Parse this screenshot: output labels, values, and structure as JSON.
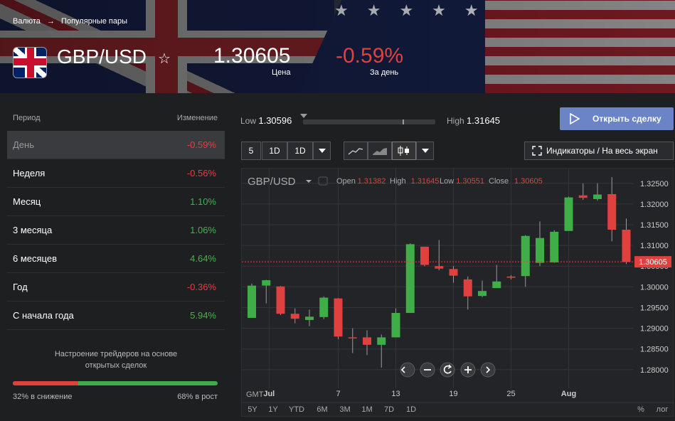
{
  "header": {
    "breadcrumb": [
      "Валюта",
      "Популярные пары"
    ],
    "pair": "GBP/USD",
    "price": "1.30605",
    "price_label": "Цена",
    "change": "-0.59%",
    "change_label": "За день"
  },
  "periods": {
    "col_period": "Период",
    "col_change": "Изменение",
    "rows": [
      {
        "label": "День",
        "value": "-0.59%"
      },
      {
        "label": "Неделя",
        "value": "-0.56%"
      },
      {
        "label": "Месяц",
        "value": "1.10%"
      },
      {
        "label": "3 месяца",
        "value": "1.06%"
      },
      {
        "label": "6 месяцев",
        "value": "4.64%"
      },
      {
        "label": "Год",
        "value": "-0.36%"
      },
      {
        "label": "С начала года",
        "value": "5.94%"
      }
    ]
  },
  "sentiment": {
    "title": "Настроение трейдеров на основе открытых сделок",
    "down_percent": 32,
    "down_label": "32% в снижение",
    "up_label": "68% в рост"
  },
  "range": {
    "low_label": "Low",
    "low": "1.30596",
    "high_label": "High",
    "high": "1.31645"
  },
  "actions": {
    "open_trade": "Открыть сделку",
    "indicators": "Индикаторы / На весь экран"
  },
  "toolbar": {
    "interval_5": "5",
    "interval_1d": "1D",
    "interval_1d_b": "1D"
  },
  "chart_data": {
    "type": "candlestick",
    "symbol": "GBP/USD",
    "ohlc_labels": {
      "open": "Open",
      "high": "High",
      "low": "Low",
      "close": "Close"
    },
    "ohlc": {
      "open": "1.31382",
      "high": "1.31645",
      "low": "1.30551",
      "close": "1.30605"
    },
    "ylim": [
      1.2755,
      1.3272
    ],
    "yticks": [
      "1.32500",
      "1.32000",
      "1.31500",
      "1.31000",
      "1.30500",
      "1.30000",
      "1.29500",
      "1.29000",
      "1.28500",
      "1.28000"
    ],
    "last_price": "1.30605",
    "last_value": 1.30605,
    "xticks": [
      {
        "label": "Jul",
        "index": 1.2
      },
      {
        "label": "7",
        "index": 6
      },
      {
        "label": "13",
        "index": 10
      },
      {
        "label": "19",
        "index": 14
      },
      {
        "label": "25",
        "index": 18
      },
      {
        "label": "Aug",
        "index": 22
      }
    ],
    "timezone": "GMT",
    "ranges": [
      "5Y",
      "1Y",
      "YTD",
      "6M",
      "3M",
      "1M",
      "7D",
      "1D"
    ],
    "scale_percent": "%",
    "scale_log": "лог",
    "candles": [
      {
        "o": 1.2925,
        "h": 1.3008,
        "l": 1.2925,
        "c": 1.3003
      },
      {
        "o": 1.3003,
        "h": 1.3017,
        "l": 1.296,
        "c": 1.3016
      },
      {
        "o": 1.3001,
        "h": 1.3002,
        "l": 1.2932,
        "c": 1.2935
      },
      {
        "o": 1.2935,
        "h": 1.2948,
        "l": 1.2912,
        "c": 1.2923
      },
      {
        "o": 1.292,
        "h": 1.2945,
        "l": 1.2905,
        "c": 1.2928
      },
      {
        "o": 1.2927,
        "h": 1.2977,
        "l": 1.2922,
        "c": 1.2974
      },
      {
        "o": 1.2972,
        "h": 1.2973,
        "l": 1.2874,
        "c": 1.288
      },
      {
        "o": 1.2878,
        "h": 1.29,
        "l": 1.284,
        "c": 1.2877
      },
      {
        "o": 1.2878,
        "h": 1.2895,
        "l": 1.2835,
        "c": 1.286
      },
      {
        "o": 1.286,
        "h": 1.2885,
        "l": 1.2805,
        "c": 1.2878
      },
      {
        "o": 1.2878,
        "h": 1.2948,
        "l": 1.2878,
        "c": 1.2937
      },
      {
        "o": 1.2937,
        "h": 1.3105,
        "l": 1.2937,
        "c": 1.3103
      },
      {
        "o": 1.3097,
        "h": 1.3097,
        "l": 1.305,
        "c": 1.3053
      },
      {
        "o": 1.305,
        "h": 1.3113,
        "l": 1.304,
        "c": 1.3044
      },
      {
        "o": 1.3043,
        "h": 1.305,
        "l": 1.301,
        "c": 1.3027
      },
      {
        "o": 1.3018,
        "h": 1.3025,
        "l": 1.2945,
        "c": 1.2977
      },
      {
        "o": 1.2978,
        "h": 1.3015,
        "l": 1.2975,
        "c": 1.299
      },
      {
        "o": 1.2997,
        "h": 1.3053,
        "l": 1.2997,
        "c": 1.3013
      },
      {
        "o": 1.3025,
        "h": 1.3028,
        "l": 1.3018,
        "c": 1.3022
      },
      {
        "o": 1.3026,
        "h": 1.3125,
        "l": 1.3,
        "c": 1.3123
      },
      {
        "o": 1.3058,
        "h": 1.3158,
        "l": 1.305,
        "c": 1.3118
      },
      {
        "o": 1.3059,
        "h": 1.3137,
        "l": 1.3058,
        "c": 1.3133
      },
      {
        "o": 1.3135,
        "h": 1.3218,
        "l": 1.3135,
        "c": 1.3216
      },
      {
        "o": 1.3221,
        "h": 1.325,
        "l": 1.321,
        "c": 1.3215
      },
      {
        "o": 1.3212,
        "h": 1.325,
        "l": 1.3208,
        "c": 1.3223
      },
      {
        "o": 1.3224,
        "h": 1.3265,
        "l": 1.311,
        "c": 1.3138
      },
      {
        "o": 1.3138,
        "h": 1.3165,
        "l": 1.3055,
        "c": 1.306
      }
    ]
  },
  "colors": {
    "up": "#3fae49",
    "down": "#e0413f",
    "accent": "#6a84c6"
  }
}
